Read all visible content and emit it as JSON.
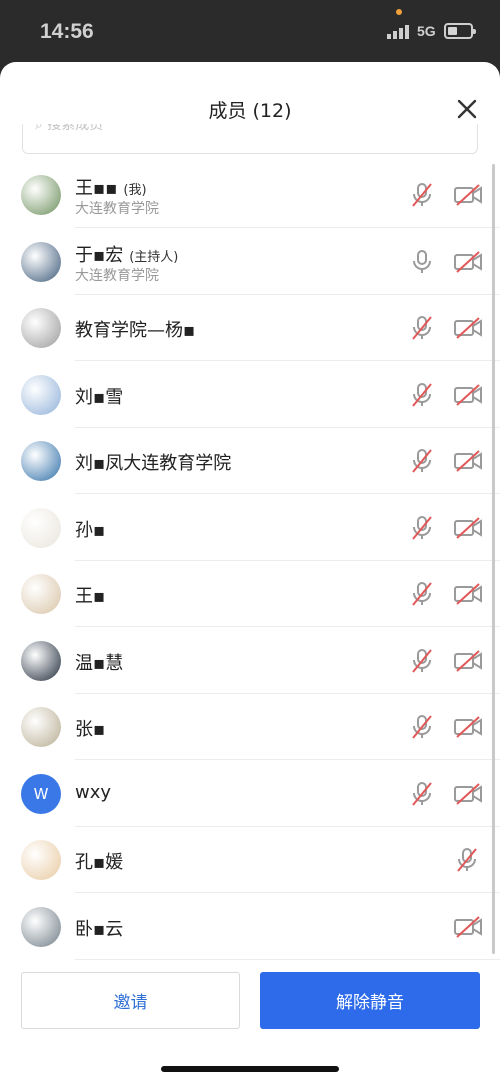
{
  "status": {
    "time": "14:56",
    "network": "5G"
  },
  "header": {
    "title": "成员 (12)"
  },
  "search": {
    "placeholder": "搜索成员"
  },
  "colors": {
    "accent": "#2d6bea",
    "muted_red": "#e25757"
  },
  "members": [
    {
      "name": "王▪▪",
      "tag": "(我)",
      "sub": "大连教育学院",
      "mic": "muted",
      "cam": "off",
      "avatar": "sunflower",
      "avatar_color": "#6b8f5a"
    },
    {
      "name": "于▪宏",
      "tag": "(主持人)",
      "sub": "大连教育学院",
      "mic": "on",
      "cam": "off",
      "avatar": "sky",
      "avatar_color": "#3d5a7a"
    },
    {
      "name": "教育学院—杨▪",
      "tag": "",
      "sub": "",
      "mic": "muted",
      "cam": "off",
      "avatar": "calligraphy",
      "avatar_color": "#9a9a9a"
    },
    {
      "name": "刘▪雪",
      "tag": "",
      "sub": "",
      "mic": "muted",
      "cam": "off",
      "avatar": "clouds",
      "avatar_color": "#8fb0d8"
    },
    {
      "name": "刘▪凤大连教育学院",
      "tag": "",
      "sub": "",
      "mic": "muted",
      "cam": "off",
      "avatar": "ocean",
      "avatar_color": "#2f6fa8"
    },
    {
      "name": "孙▪",
      "tag": "",
      "sub": "",
      "mic": "muted",
      "cam": "off",
      "avatar": "person",
      "avatar_color": "#e9e4dc"
    },
    {
      "name": "王▪",
      "tag": "",
      "sub": "",
      "mic": "muted",
      "cam": "off",
      "avatar": "cartoon",
      "avatar_color": "#d8c3a5"
    },
    {
      "name": "温▪慧",
      "tag": "",
      "sub": "",
      "mic": "muted",
      "cam": "off",
      "avatar": "painting",
      "avatar_color": "#1f2a3a"
    },
    {
      "name": "张▪",
      "tag": "",
      "sub": "",
      "mic": "muted",
      "cam": "off",
      "avatar": "blur",
      "avatar_color": "#b8ad92"
    },
    {
      "name": "wxy",
      "tag": "",
      "sub": "",
      "mic": "muted",
      "cam": "off",
      "avatar": "letter",
      "avatar_letter": "W",
      "avatar_color": "#3a78e8"
    },
    {
      "name": "孔▪媛",
      "tag": "",
      "sub": "",
      "mic": "muted",
      "cam": "none",
      "avatar": "illustration",
      "avatar_color": "#e8c9a0"
    },
    {
      "name": "卧▪云",
      "tag": "",
      "sub": "",
      "mic": "none",
      "cam": "off",
      "avatar": "photo",
      "avatar_color": "#6f7d86"
    }
  ],
  "actions": {
    "invite_label": "邀请",
    "unmute_label": "解除静音"
  }
}
